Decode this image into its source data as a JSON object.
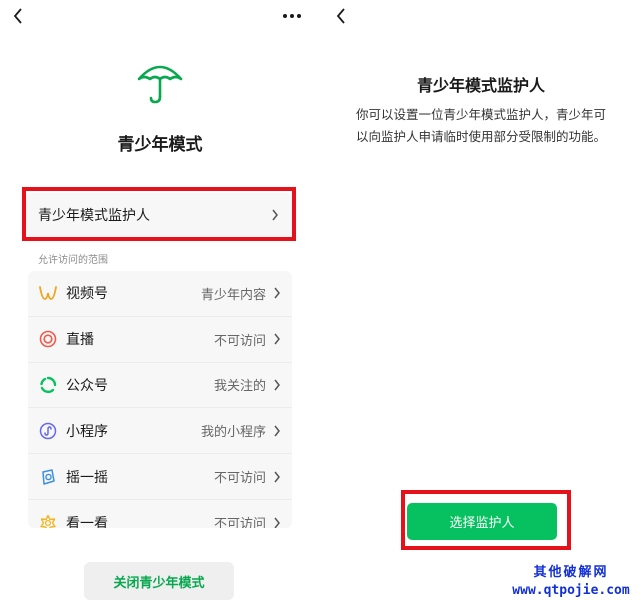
{
  "left": {
    "title": "青少年模式",
    "guardian_label": "青少年模式监护人",
    "section_caption": "允许访问的范围",
    "scope_items": [
      {
        "label": "视频号",
        "value": "青少年内容",
        "icon": "channels-icon",
        "color": "#f2a51a"
      },
      {
        "label": "直播",
        "value": "不可访问",
        "icon": "live-icon",
        "color": "#f05a4b"
      },
      {
        "label": "公众号",
        "value": "我关注的",
        "icon": "official-account-icon",
        "color": "#07c160"
      },
      {
        "label": "小程序",
        "value": "我的小程序",
        "icon": "mini-program-icon",
        "color": "#6467f0"
      },
      {
        "label": "摇一摇",
        "value": "不可访问",
        "icon": "shake-icon",
        "color": "#3b8fe0"
      },
      {
        "label": "看一看",
        "value": "不可访问",
        "icon": "top-stories-icon",
        "color": "#f2b620"
      }
    ],
    "close_label": "关闭青少年模式"
  },
  "right": {
    "title": "青少年模式监护人",
    "description": "你可以设置一位青少年模式监护人，青少年可以向监护人申请临时使用部分受限制的功能。",
    "select_label": "选择监护人"
  },
  "watermark": {
    "line1": "其他破解网",
    "line2": "www.qtpojie.com"
  },
  "colors": {
    "accent_green": "#07c160",
    "highlight_red": "#e5121c",
    "umbrella_green": "#07a84e"
  }
}
